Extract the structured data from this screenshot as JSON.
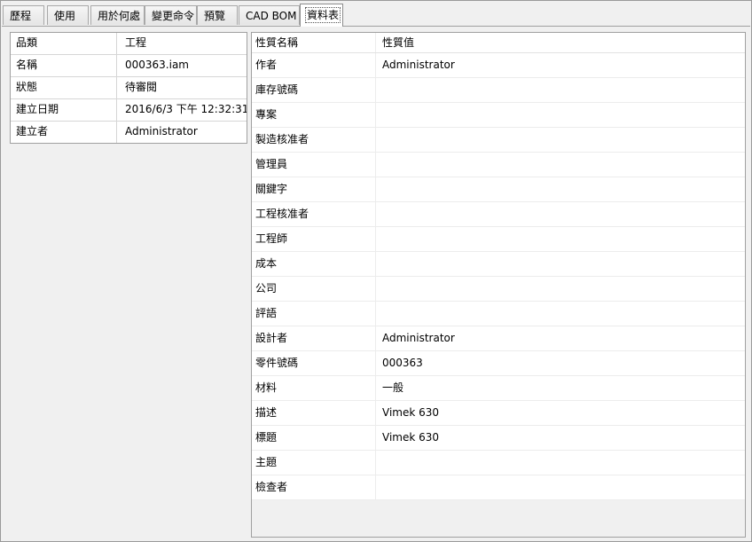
{
  "tabs": [
    "歷程",
    "使用",
    "用於何處",
    "變更命令",
    "預覽",
    "CAD BOM",
    "資料表"
  ],
  "summary": [
    {
      "key": "品類",
      "value": "工程"
    },
    {
      "key": "名稱",
      "value": "000363.iam"
    },
    {
      "key": "狀態",
      "value": "待審閱"
    },
    {
      "key": "建立日期",
      "value": "2016/6/3 下午 12:32:31"
    },
    {
      "key": "建立者",
      "value": "Administrator"
    }
  ],
  "properties": {
    "headers": {
      "name": "性質名稱",
      "value": "性質值"
    },
    "rows": [
      {
        "name": "作者",
        "value": "Administrator"
      },
      {
        "name": "庫存號碼",
        "value": ""
      },
      {
        "name": "專案",
        "value": ""
      },
      {
        "name": "製造核准者",
        "value": ""
      },
      {
        "name": "管理員",
        "value": ""
      },
      {
        "name": "關鍵字",
        "value": ""
      },
      {
        "name": "工程核准者",
        "value": ""
      },
      {
        "name": "工程師",
        "value": ""
      },
      {
        "name": "成本",
        "value": ""
      },
      {
        "name": "公司",
        "value": ""
      },
      {
        "name": "評語",
        "value": ""
      },
      {
        "name": "設計者",
        "value": "Administrator"
      },
      {
        "name": "零件號碼",
        "value": "000363"
      },
      {
        "name": "材料",
        "value": "一般"
      },
      {
        "name": "描述",
        "value": "Vimek 630"
      },
      {
        "name": "標題",
        "value": "Vimek 630"
      },
      {
        "name": "主題",
        "value": ""
      },
      {
        "name": "檢查者",
        "value": ""
      }
    ]
  }
}
